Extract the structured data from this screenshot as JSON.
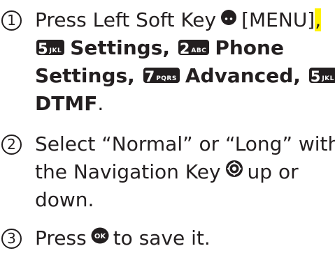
{
  "steps": [
    {
      "number": "1",
      "line1": {
        "press": "Press Left Soft Key",
        "menu_pre": "[MENU]",
        "menu_hl": ","
      },
      "line2": {
        "key1_digit": "5",
        "key1_letters": "JKL",
        "settings": "Settings",
        "comma": ",",
        "key2_digit": "2",
        "key2_letters": "ABC",
        "phone": "Phone"
      },
      "line3": {
        "phone_settings": "Settings",
        "comma": ",",
        "key3_digit": "7",
        "key3_letters": "PQRS",
        "advanced": "Advanced",
        "comma2": ",",
        "key4_digit": "5",
        "key4_letters": "JKL"
      },
      "line4": {
        "dtmf": "DTMF",
        "period": "."
      }
    },
    {
      "number": "2",
      "line1": "Select “Normal” or “Long” with",
      "line2_pre": "the Navigation Key",
      "line2_post": "up or",
      "line3": "down."
    },
    {
      "number": "3",
      "pre": "Press",
      "ok_label": "OK",
      "post": "to save it."
    }
  ],
  "colors": {
    "text": "#231f20",
    "highlight": "#fff200"
  },
  "icons": [
    "left-soft-key-icon",
    "navigation-key-icon",
    "ok-key-icon"
  ]
}
